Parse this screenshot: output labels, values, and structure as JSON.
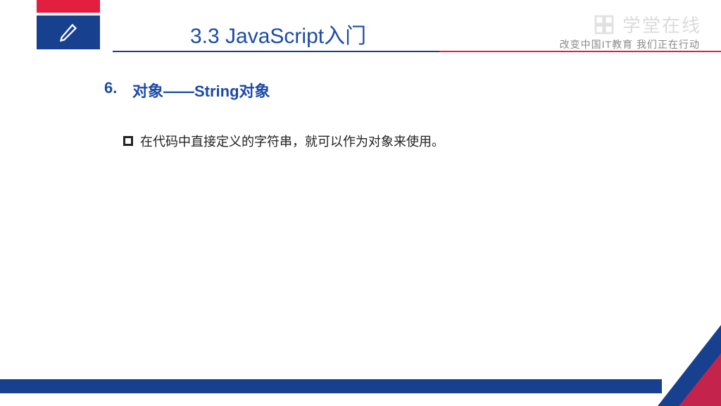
{
  "header": {
    "title": "3.3 JavaScript入门",
    "tagline": "改变中国IT教育 我们正在行动",
    "watermark": "学堂在线"
  },
  "section": {
    "number": "6.",
    "title": "对象——String对象"
  },
  "content": {
    "bullet": "在代码中直接定义的字符串，就可以作为对象来使用。"
  }
}
